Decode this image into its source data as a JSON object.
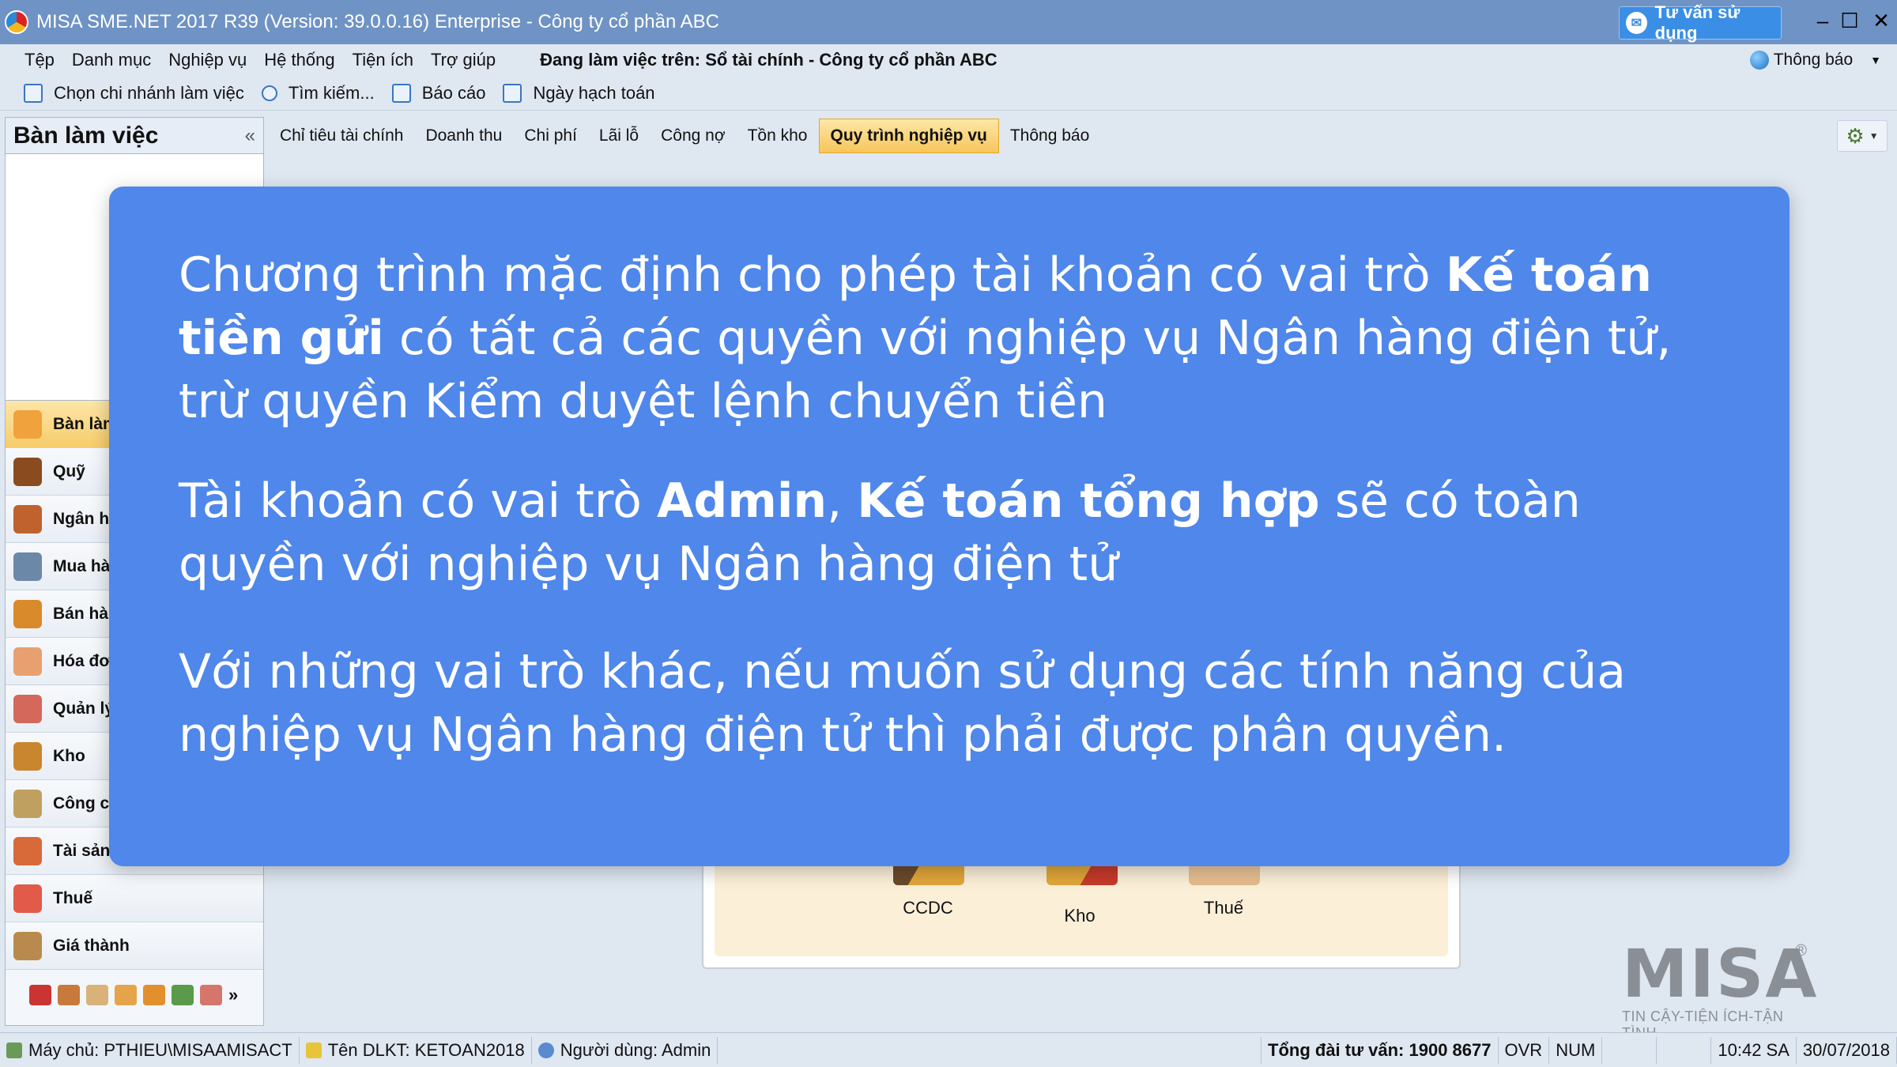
{
  "window": {
    "title": "MISA SME.NET 2017 R39 (Version: 39.0.0.16) Enterprise - Công ty cổ phần ABC",
    "consult_button": "Tư vấn sử dụng"
  },
  "menu": {
    "items": [
      "Tệp",
      "Danh mục",
      "Nghiệp vụ",
      "Hệ thống",
      "Tiện ích",
      "Trợ giúp"
    ],
    "working_on": "Đang làm việc trên: Sổ tài chính - Công ty cổ phần ABC",
    "notification": "Thông báo"
  },
  "toolbar": {
    "items": [
      "Chọn chi nhánh làm việc",
      "Tìm kiếm...",
      "Báo cáo",
      "Ngày hạch toán"
    ]
  },
  "left_panel": {
    "title": "Bàn làm việc",
    "items": [
      "Bàn làm việc",
      "Quỹ",
      "Ngân hàng",
      "Mua hàng",
      "Bán hàng",
      "Hóa đơn",
      "Quản lý",
      "Kho",
      "Công cụ dụng cụ",
      "Tài sản cố định",
      "Thuế",
      "Giá thành"
    ]
  },
  "tabs": [
    "Chỉ tiêu tài chính",
    "Doanh thu",
    "Chi phí",
    "Lãi lỗ",
    "Công nợ",
    "Tồn kho",
    "Quy trình nghiệp vụ",
    "Thông báo"
  ],
  "active_tab_index": 6,
  "process": {
    "items": [
      "CCDC",
      "Kho",
      "Thuế"
    ]
  },
  "overlay": {
    "p1_a": "Chương trình mặc định cho phép tài khoản có vai trò ",
    "p1_bold": "Kế toán tiền gửi",
    "p1_b": " có tất cả các quyền với nghiệp vụ Ngân hàng điện tử, trừ quyền Kiểm duyệt lệnh chuyển tiền",
    "p2_a": "Tài khoản có vai trò ",
    "p2_bold1": "Admin",
    "p2_sep": ", ",
    "p2_bold2": "Kế toán tổng hợp",
    "p2_b": " sẽ có toàn quyền với nghiệp vụ Ngân hàng điện tử",
    "p3": "Với những vai trò khác, nếu muốn sử dụng các tính năng của nghiệp vụ Ngân hàng điện tử thì phải được phân quyền."
  },
  "logo": {
    "text": "MISA",
    "tagline": "TIN CẬY-TIỆN ÍCH-TẬN TÌNH",
    "reg": "®"
  },
  "status": {
    "server": "Máy chủ: PTHIEU\\MISAAMISACT",
    "dlkt": "Tên DLKT: KETOAN2018",
    "user": "Người dùng: Admin",
    "hotline": "Tổng đài tư vấn: 1900 8677",
    "ovr": "OVR",
    "num": "NUM",
    "time": "10:42 SA",
    "date": "30/07/2018"
  },
  "colors": {
    "overlay_bg": "#4f87ea",
    "title_bar": "#6f93c4",
    "active_tab": "#f6c65b"
  }
}
